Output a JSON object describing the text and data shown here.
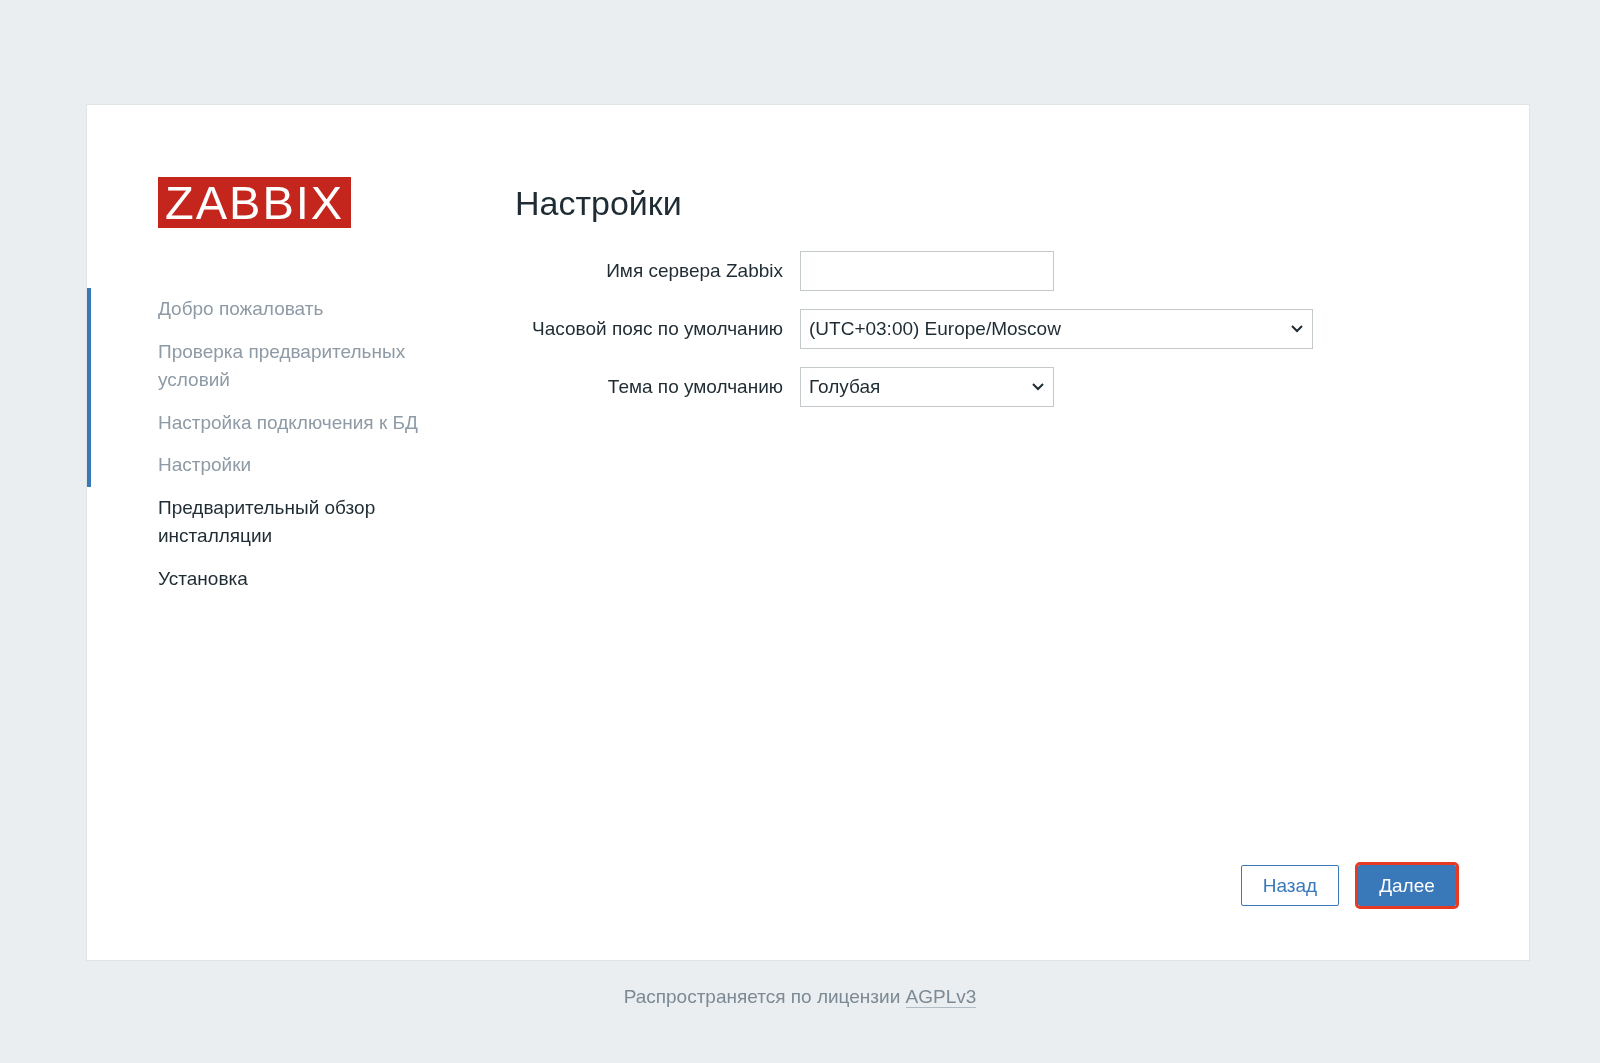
{
  "logo": {
    "text": "ZABBIX"
  },
  "steps": [
    {
      "label": "Добро пожаловать",
      "done": true
    },
    {
      "label": "Проверка предварительных условий",
      "done": true
    },
    {
      "label": "Настройка подключения к БД",
      "done": true
    },
    {
      "label": "Настройки",
      "done": true
    },
    {
      "label": "Предварительный обзор инсталляции",
      "done": false
    },
    {
      "label": "Установка",
      "done": false
    }
  ],
  "title": "Настройки",
  "fields": [
    {
      "kind": "text",
      "label": "Имя сервера Zabbix",
      "wide": false
    },
    {
      "kind": "select",
      "label": "Часовой пояс по умолчанию",
      "value": "(UTC+03:00) Europe/Moscow",
      "wide": true
    },
    {
      "kind": "select",
      "label": "Тема по умолчанию",
      "value": "Голубая",
      "wide": false
    }
  ],
  "buttons": [
    {
      "label": "Назад",
      "kind": "secondary",
      "highlighted": false
    },
    {
      "label": "Далее",
      "kind": "primary",
      "highlighted": true
    }
  ],
  "footer": {
    "text": "Распространяется по лицензии",
    "link": "AGPLv3"
  }
}
